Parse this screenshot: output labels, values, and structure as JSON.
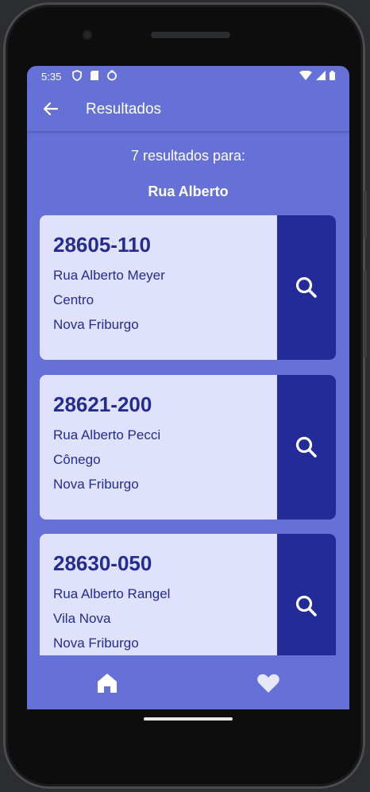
{
  "status": {
    "time": "5:35"
  },
  "appbar": {
    "title": "Resultados"
  },
  "results": {
    "count_label": "7 resultados para:",
    "query": "Rua Alberto"
  },
  "cards": [
    {
      "cep": "28605-110",
      "street": "Rua Alberto Meyer",
      "district": "Centro",
      "city": "Nova Friburgo"
    },
    {
      "cep": "28621-200",
      "street": "Rua Alberto Pecci",
      "district": "Cônego",
      "city": "Nova Friburgo"
    },
    {
      "cep": "28630-050",
      "street": "Rua Alberto Rangel",
      "district": "Vila Nova",
      "city": "Nova Friburgo"
    }
  ],
  "icons": {
    "back": "arrow-left-icon",
    "search": "search-icon",
    "home": "home-icon",
    "favorite": "heart-icon"
  },
  "colors": {
    "primary": "#6571d6",
    "card": "#dfe1fd",
    "accent": "#222b97",
    "text": "#232c91"
  }
}
